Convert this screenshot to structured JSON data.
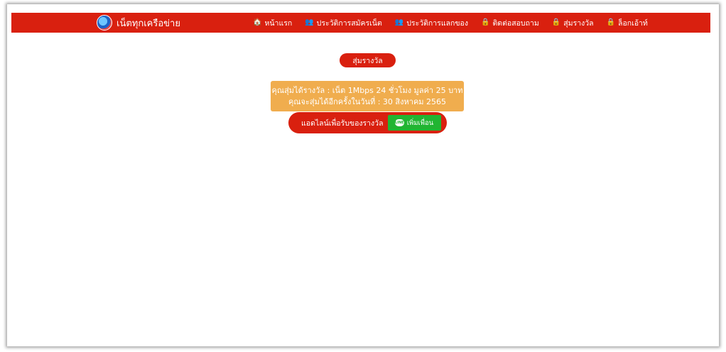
{
  "brand": {
    "title": "เน็ตทุกเครือข่าย",
    "logo_icon": "globe-logo"
  },
  "nav": {
    "items": [
      {
        "icon": "home-icon",
        "glyph": "🏠",
        "label": "หน้าแรก"
      },
      {
        "icon": "users-icon",
        "glyph": "👥",
        "label": "ประวัติการสมัครเน็ต"
      },
      {
        "icon": "users-icon",
        "glyph": "👥",
        "label": "ประวัติการแลกของ"
      },
      {
        "icon": "lock-icon",
        "glyph": "🔒",
        "label": "ติดต่อสอบถาม"
      },
      {
        "icon": "lock-icon",
        "glyph": "🔒",
        "label": "สุ่มรางวัล"
      },
      {
        "icon": "lock-icon",
        "glyph": "🔒",
        "label": "ล็อกเอ้าท์"
      }
    ]
  },
  "draw_button": {
    "label": "สุ่มรางวัล"
  },
  "result": {
    "line1": "คุณสุ่มได้รางวัล : เน็ต 1Mbps 24 ชั่วโมง มูลค่า 25 บาท",
    "line2": "คุณจะสุ่มได้อีกครั้งในวันที่ : 30 สิงหาคม 2565"
  },
  "line_cta": {
    "text": "แอดไลน์เพื่อรับของรางวัล",
    "button_label": "เพิ่มเพื่อน",
    "button_icon": "LINE"
  },
  "colors": {
    "nav_red": "#d9200f",
    "result_orange": "#f0ad4e",
    "line_green": "#21b532"
  }
}
